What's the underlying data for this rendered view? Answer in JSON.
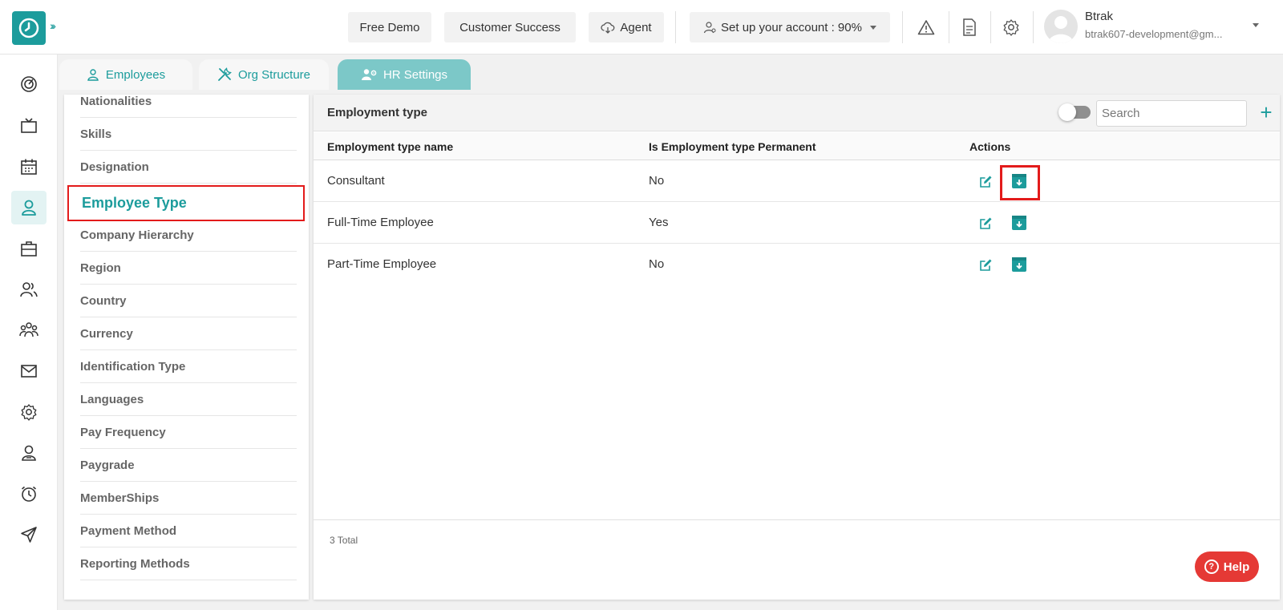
{
  "header": {
    "buttons": {
      "free_demo": "Free Demo",
      "customer_success": "Customer Success",
      "agent": "Agent",
      "setup_account": "Set up your account : 90%"
    },
    "user": {
      "name": "Btrak",
      "email": "btrak607-development@gm..."
    }
  },
  "tabs": [
    {
      "label": "Employees",
      "icon": "user-icon"
    },
    {
      "label": "Org Structure",
      "icon": "tools-icon"
    },
    {
      "label": "HR Settings",
      "icon": "users-gear-icon",
      "active": true
    }
  ],
  "settings_list": [
    "Nationalities",
    "Skills",
    "Designation",
    "Employee Type",
    "Company Hierarchy",
    "Region",
    "Country",
    "Currency",
    "Identification Type",
    "Languages",
    "Pay Frequency",
    "Paygrade",
    "MemberShips",
    "Payment Method",
    "Reporting Methods"
  ],
  "selected_setting": "Employee Type",
  "panel": {
    "title": "Employment type",
    "search_placeholder": "Search",
    "add_label": "+",
    "columns": [
      "Employment type name",
      "Is Employment type Permanent",
      "Actions"
    ],
    "rows": [
      {
        "name": "Consultant",
        "permanent": "No"
      },
      {
        "name": "Full-Time Employee",
        "permanent": "Yes"
      },
      {
        "name": "Part-Time Employee",
        "permanent": "No"
      }
    ],
    "total": "3 Total"
  },
  "help_label": "Help",
  "colors": {
    "accent": "#1c9c9c",
    "highlight": "#e31b1b",
    "help": "#e53935"
  }
}
